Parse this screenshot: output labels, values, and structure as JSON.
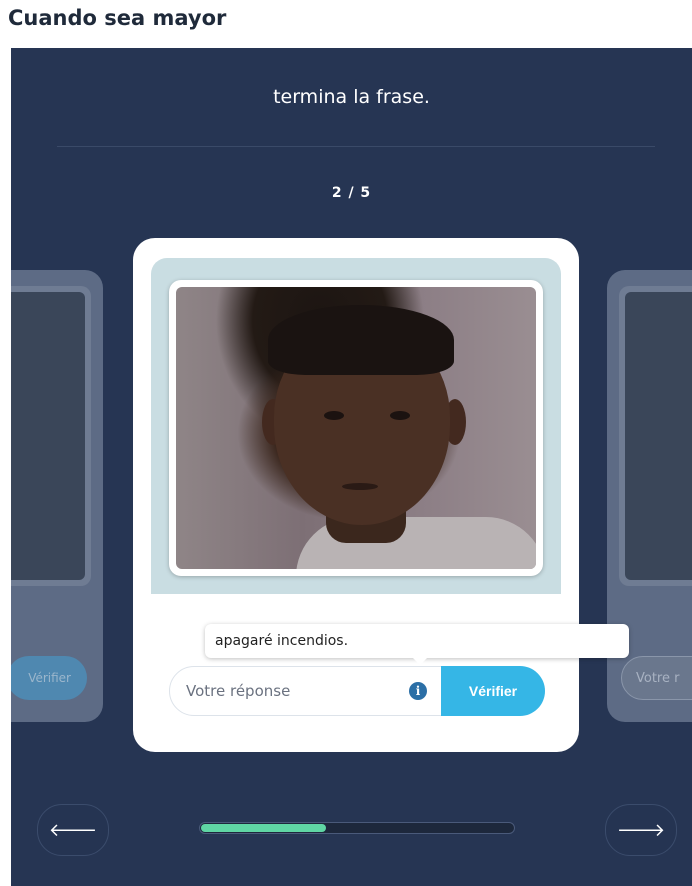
{
  "page": {
    "title": "Cuando sea mayor"
  },
  "exercise": {
    "instruction": "termina la frase.",
    "counter": "2 / 5",
    "hint_text": "apagaré incendios.",
    "answer_placeholder": "Votre réponse",
    "verify_label": "Vérifier",
    "info_icon_glyph": "i"
  },
  "ghost_cards": {
    "left_button_label": "Vérifier",
    "right_input_text": "Votre r"
  },
  "navigation": {
    "prev_icon": "arrow-left-icon",
    "next_icon": "arrow-right-icon",
    "prev_glyph": "🡐",
    "next_glyph": "🡒",
    "progress_fraction": 0.4
  },
  "colors": {
    "panel_background": "#263553",
    "verify_button": "#35b6e6",
    "progress_fill": "#5fd6a4",
    "info_icon": "#2b6fa6"
  }
}
